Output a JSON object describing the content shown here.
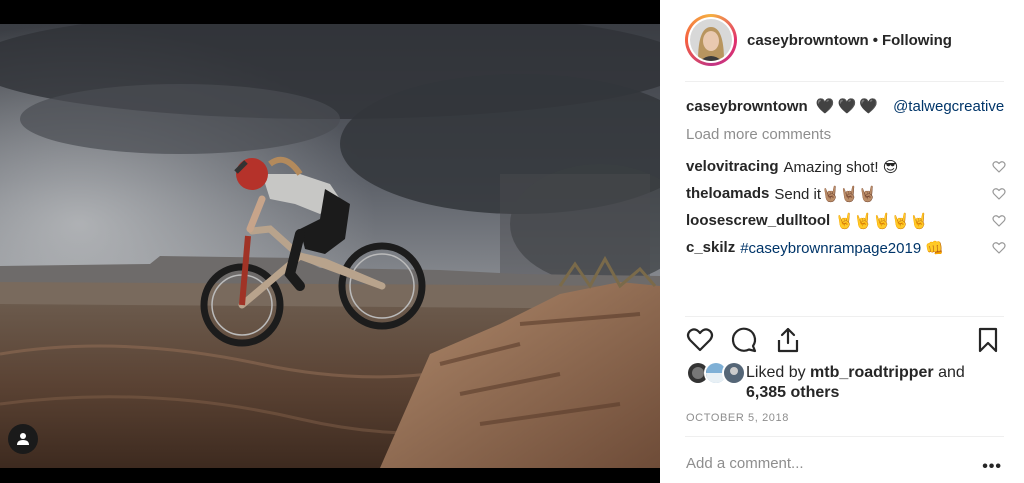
{
  "post": {
    "username": "caseybrowntown",
    "follow_separator": "•",
    "follow_status": "Following",
    "caption": {
      "user": "caseybrowntown",
      "hearts": "🖤🖤🖤",
      "mention": "@talwegcreative"
    },
    "load_more_label": "Load more comments",
    "comments": [
      {
        "user": "velovitracing",
        "text": "Amazing shot! 😎",
        "is_tag": false
      },
      {
        "user": "theloamads",
        "text": "Send it🤘🏽🤘🏽🤘🏽",
        "is_tag": false
      },
      {
        "user": "loosescrew_dulltool",
        "text": "🤘🤘🤘🤘🤘",
        "is_tag": false
      },
      {
        "user": "c_skilz",
        "text": "#caseybrownrampage2019 👊",
        "is_tag": true
      }
    ],
    "likes": {
      "prefix": "Liked by",
      "user": "mtb_roadtripper",
      "conjunction": "and",
      "others": "6,385 others"
    },
    "date": "OCTOBER 5, 2018",
    "add_comment_placeholder": "Add a comment...",
    "more_options": "•••"
  },
  "icons": {
    "like": "heart-icon",
    "comment": "comment-bubble-icon",
    "share": "share-icon",
    "save": "bookmark-icon",
    "comment_like": "small-heart-icon",
    "tag": "user-tag-icon"
  },
  "colors": {
    "link": "#003569",
    "muted": "#8e8e8e",
    "text": "#262626",
    "separator": "#efefef"
  }
}
